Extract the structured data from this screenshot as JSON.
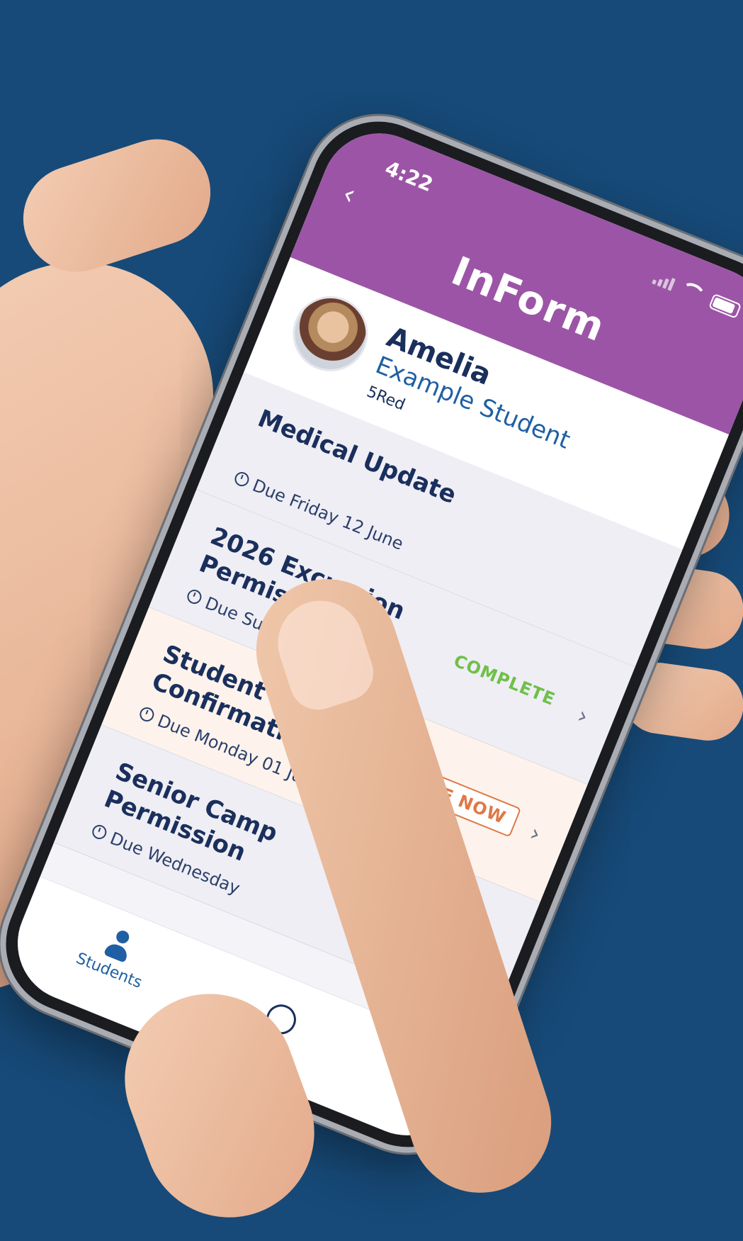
{
  "status_bar": {
    "time": "4:22"
  },
  "header": {
    "title": "InForm",
    "back_icon": "chevron-left-icon"
  },
  "student": {
    "first_name": "Amelia",
    "last_name": "Example Student",
    "class": "5Red"
  },
  "forms": [
    {
      "title": "Medical Update",
      "due": "Due Friday 12 June",
      "badge": ""
    },
    {
      "title": "2026 Excursion Permission",
      "due": "Due Sunday",
      "badge": "COMPLETE"
    },
    {
      "title": "Student Details Confirmation",
      "due": "Due Monday 01 June",
      "badge": "DUE NOW"
    },
    {
      "title": "Senior Camp Permission",
      "due": "Due Wednesday",
      "badge": ""
    }
  ],
  "tab_bar": {
    "students_label": "Students"
  },
  "colors": {
    "background": "#174a78",
    "header": "#9c55a6",
    "navy_text": "#1a2f5c",
    "blue_text": "#1f5fa3",
    "complete": "#6fc04a",
    "due_now": "#e07845"
  }
}
